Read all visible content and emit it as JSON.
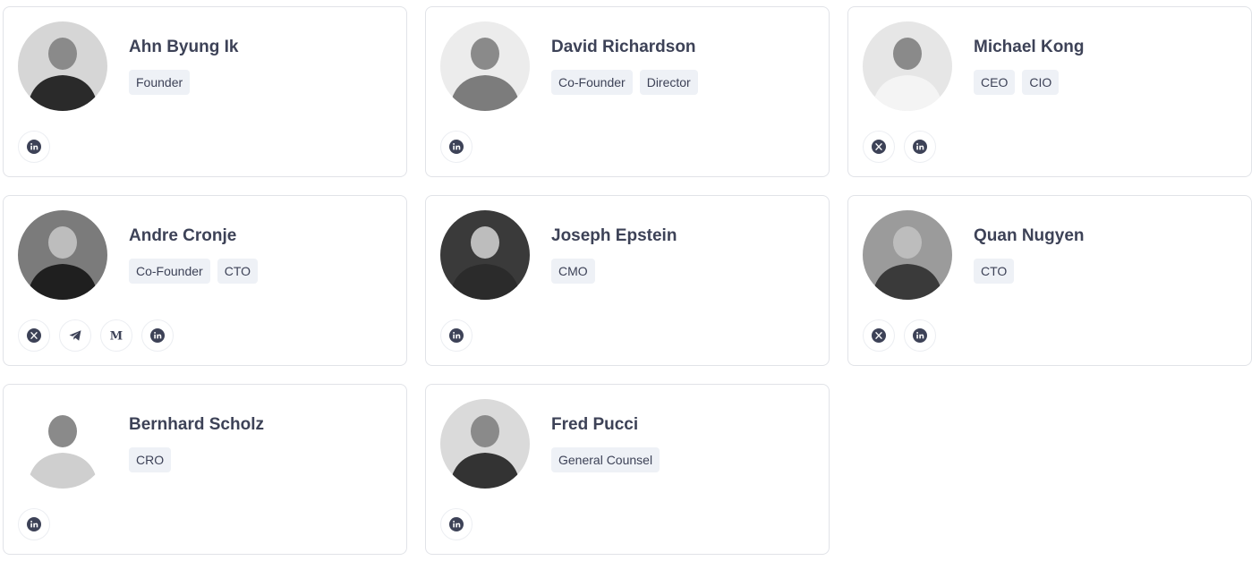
{
  "team": [
    {
      "name": "Ahn Byung Ik",
      "roles": [
        "Founder"
      ],
      "socials": [
        "linkedin-icon"
      ]
    },
    {
      "name": "David Richardson",
      "roles": [
        "Co-Founder",
        "Director"
      ],
      "socials": [
        "linkedin-icon"
      ]
    },
    {
      "name": "Michael Kong",
      "roles": [
        "CEO",
        "CIO"
      ],
      "socials": [
        "x-icon",
        "linkedin-icon"
      ]
    },
    {
      "name": "Andre Cronje",
      "roles": [
        "Co-Founder",
        "CTO"
      ],
      "socials": [
        "x-icon",
        "telegram-icon",
        "medium-icon",
        "linkedin-icon"
      ]
    },
    {
      "name": "Joseph Epstein",
      "roles": [
        "CMO"
      ],
      "socials": [
        "linkedin-icon"
      ]
    },
    {
      "name": "Quan Nugyen",
      "roles": [
        "CTO"
      ],
      "socials": [
        "x-icon",
        "linkedin-icon"
      ]
    },
    {
      "name": "Bernhard Scholz",
      "roles": [
        "CRO"
      ],
      "socials": [
        "linkedin-icon"
      ]
    },
    {
      "name": "Fred Pucci",
      "roles": [
        "General Counsel"
      ],
      "socials": [
        "linkedin-icon"
      ]
    }
  ],
  "colors": {
    "icon_dark": "#3d4257",
    "role_bg": "#eef1f6",
    "border": "#e1e3e8"
  }
}
